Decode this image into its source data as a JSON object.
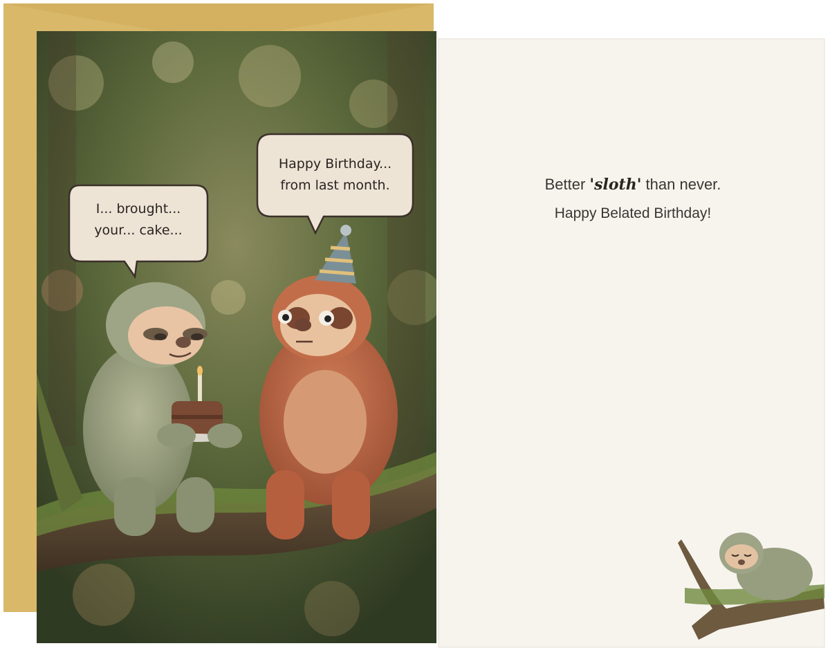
{
  "front_card": {
    "bubble_left": {
      "line1": "I... brought...",
      "line2": "your... cake..."
    },
    "bubble_right": {
      "line1": "Happy Birthday...",
      "line2": "from last month."
    }
  },
  "inside_card": {
    "line1_before": "Better ",
    "line1_script": "'sloth'",
    "line1_after": " than never.",
    "line2": "Happy Belated Birthday!"
  },
  "colors": {
    "envelope": "#d9b86a",
    "inside_paper": "#f7f4ee",
    "forest": "#4d5a33",
    "green_sloth": "#9aa184",
    "red_sloth": "#bd6a48"
  }
}
